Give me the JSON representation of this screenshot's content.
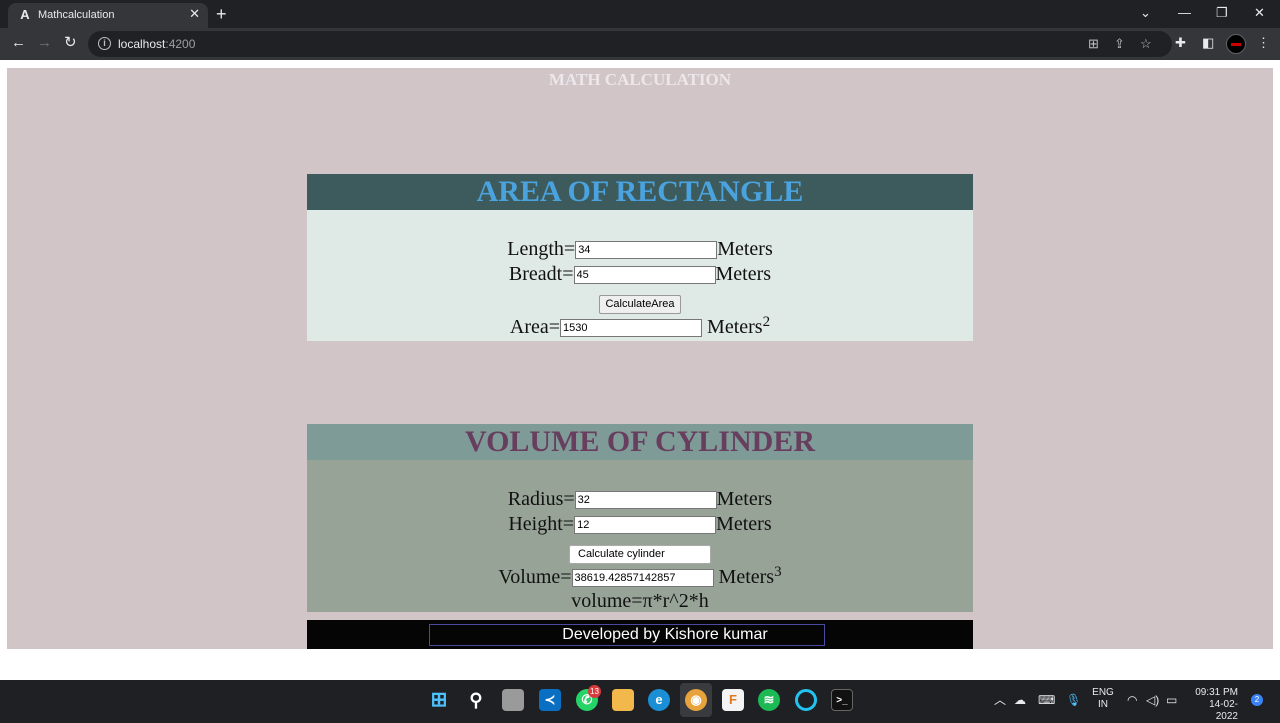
{
  "browser": {
    "tab_favicon": "A",
    "tab_title": "Mathcalculation",
    "url_host": "localhost",
    "url_port": ":4200"
  },
  "page": {
    "title": "MATH CALCULATION",
    "rectangle": {
      "heading": "AREA OF RECTANGLE",
      "length_label": "Length=",
      "length_value": "34",
      "breadth_label": "Breadt=",
      "breadth_value": "45",
      "unit": "Meters",
      "button": "CalculateArea",
      "area_label": "Area=",
      "area_value": "1530",
      "area_unit": "Meters",
      "area_exp": "2"
    },
    "cylinder": {
      "heading": "VOLUME OF CYLINDER",
      "radius_label": "Radius=",
      "radius_value": "32",
      "height_label": "Height=",
      "height_value": "12",
      "unit": "Meters",
      "button": "Calculate cylinder",
      "volume_label": "Volume=",
      "volume_value": "38619.42857142857",
      "volume_unit": "Meters",
      "volume_exp": "3",
      "formula": "volume=π*r^2*h"
    },
    "footer": "Developed by Kishore kumar"
  },
  "taskbar": {
    "whatsapp_badge": "13",
    "lang_line1": "ENG",
    "lang_line2": "IN",
    "time": "09:31 PM",
    "date": "14-02-2022",
    "notifications": "2"
  }
}
